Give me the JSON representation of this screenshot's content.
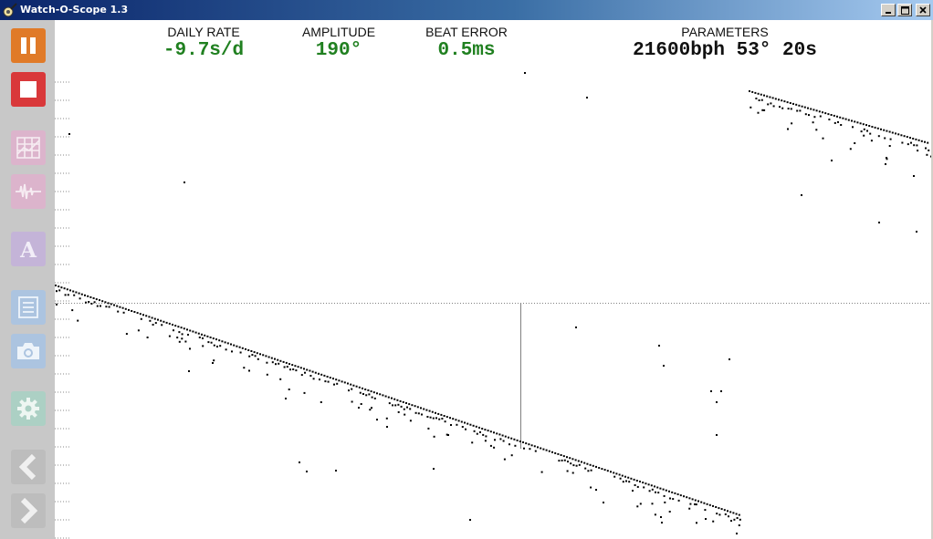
{
  "window": {
    "title": "Watch-O-Scope 1.3",
    "controls": [
      "minimize",
      "maximize",
      "close"
    ]
  },
  "toolbar": {
    "buttons": [
      {
        "name": "pause-button",
        "icon": "pause-icon",
        "color": "#e07a28",
        "enabled": true
      },
      {
        "name": "stop-button",
        "icon": "stop-icon",
        "color": "#d9383a",
        "enabled": true
      },
      {
        "name": "trace-view-button",
        "icon": "grid-chart-icon",
        "color": "#d9a4c4",
        "enabled": false
      },
      {
        "name": "waveform-view-button",
        "icon": "waveform-icon",
        "color": "#d9a4c4",
        "enabled": false
      },
      {
        "name": "font-button",
        "icon": "letter-a-icon",
        "color": "#b8a4cc",
        "enabled": false
      },
      {
        "name": "log-button",
        "icon": "list-icon",
        "color": "#a4bcd8",
        "enabled": false
      },
      {
        "name": "snapshot-button",
        "icon": "camera-icon",
        "color": "#a4bcd8",
        "enabled": false
      },
      {
        "name": "settings-button",
        "icon": "gear-icon",
        "color": "#a4c8b8",
        "enabled": false
      },
      {
        "name": "previous-button",
        "icon": "chevron-left-icon",
        "color": "#b8b8b8",
        "enabled": false
      },
      {
        "name": "next-button",
        "icon": "chevron-right-icon",
        "color": "#b8b8b8",
        "enabled": false
      }
    ]
  },
  "readouts": {
    "daily_rate": {
      "label": "DAILY RATE",
      "value": "-9.7s/d"
    },
    "amplitude": {
      "label": "AMPLITUDE",
      "value": "190°"
    },
    "beat_error": {
      "label": "BEAT ERROR",
      "value": "0.5ms"
    },
    "parameters": {
      "label": "PARAMETERS",
      "value": "21600bph 53° 20s"
    }
  },
  "colors": {
    "value_green": "#208020",
    "trace_dot": "#000000",
    "center_line": "#808080"
  },
  "trace": {
    "trend_rate": -9.7,
    "wrap": true,
    "center_line": "horizontal dotted, vertical cursor"
  }
}
